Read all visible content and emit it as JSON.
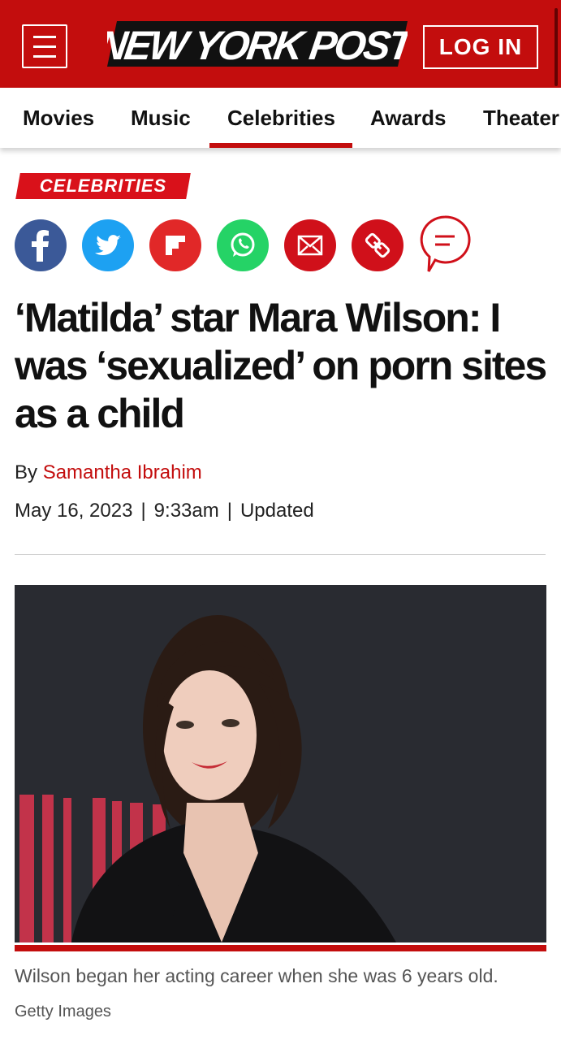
{
  "header": {
    "logo_text": "NEW YORK POST",
    "login_label": "LOG IN",
    "menu_icon": "hamburger-icon",
    "brand_color": "#c30d0d"
  },
  "nav": {
    "items": [
      {
        "label": "Movies"
      },
      {
        "label": "Music"
      },
      {
        "label": "Celebrities",
        "active": true
      },
      {
        "label": "Awards"
      },
      {
        "label": "Theater"
      }
    ]
  },
  "article": {
    "section": "CELEBRITIES",
    "share_icons": [
      "facebook-icon",
      "twitter-icon",
      "flipboard-icon",
      "whatsapp-icon",
      "email-icon",
      "link-icon",
      "comment-icon"
    ],
    "headline": "‘Matilda’ star Mara Wilson: I was ‘sexualized’ on porn sites as a child",
    "byline_prefix": "By",
    "author": "Samantha Ibrahim",
    "date": "May 16, 2023",
    "time": "9:33am",
    "updated_label": "Updated",
    "image_caption": "Wilson began her acting career when she was 6 years old.",
    "image_credit": "Getty Images"
  }
}
